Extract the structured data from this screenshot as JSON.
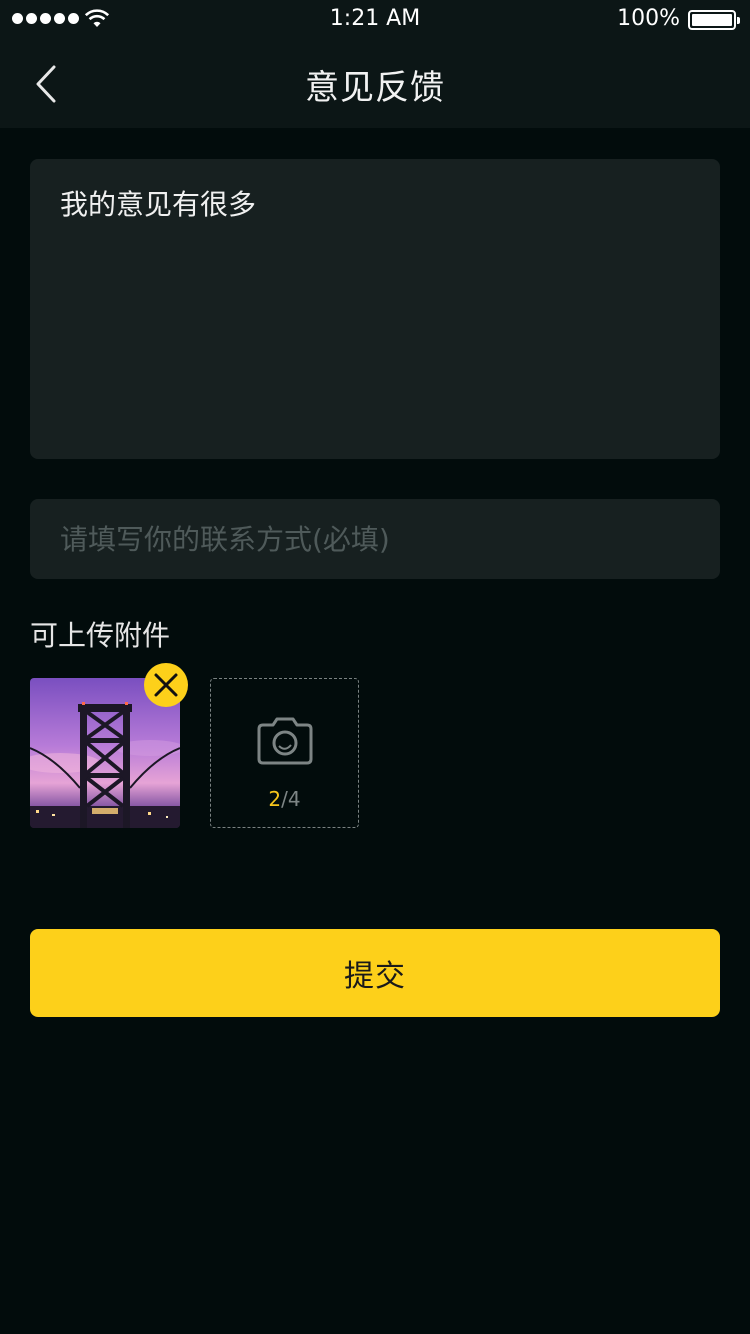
{
  "status_bar": {
    "time": "1:21 AM",
    "battery_percent": "100%",
    "signal_icon": "signal-dots-icon",
    "wifi_icon": "wifi-icon",
    "battery_icon": "battery-icon"
  },
  "nav": {
    "title": "意见反馈",
    "back_icon": "chevron-left-icon"
  },
  "feedback": {
    "value": "我的意见有很多"
  },
  "contact": {
    "value": "",
    "placeholder": "请填写你的联系方式(必填)"
  },
  "attachments": {
    "label": "可上传附件",
    "count_current": "2",
    "count_separator": "/",
    "count_max": "4",
    "remove_icon": "close-icon",
    "add_icon": "camera-icon"
  },
  "submit": {
    "label": "提交"
  },
  "colors": {
    "background": "#020c0c",
    "bar_background": "#0c1616",
    "field_background": "#172020",
    "accent": "#fdd01a",
    "placeholder": "#4f5a5a"
  }
}
